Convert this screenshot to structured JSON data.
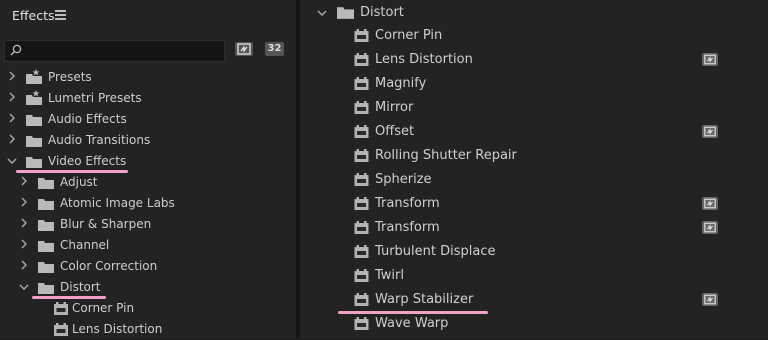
{
  "left_panel": {
    "title": "Effects",
    "search": {
      "value": "",
      "placeholder": ""
    },
    "badge_32": "32",
    "tree": [
      {
        "label": "Presets",
        "level": 0,
        "expanded": false,
        "icon": "preset-folder-icon"
      },
      {
        "label": "Lumetri Presets",
        "level": 0,
        "expanded": false,
        "icon": "preset-folder-icon"
      },
      {
        "label": "Audio Effects",
        "level": 0,
        "expanded": false,
        "icon": "folder-icon"
      },
      {
        "label": "Audio Transitions",
        "level": 0,
        "expanded": false,
        "icon": "folder-icon"
      },
      {
        "label": "Video Effects",
        "level": 0,
        "expanded": true,
        "icon": "folder-icon",
        "highlighted": true
      },
      {
        "label": "Adjust",
        "level": 1,
        "expanded": false,
        "icon": "folder-icon"
      },
      {
        "label": "Atomic Image Labs",
        "level": 1,
        "expanded": false,
        "icon": "folder-icon"
      },
      {
        "label": "Blur & Sharpen",
        "level": 1,
        "expanded": false,
        "icon": "folder-icon"
      },
      {
        "label": "Channel",
        "level": 1,
        "expanded": false,
        "icon": "folder-icon"
      },
      {
        "label": "Color Correction",
        "level": 1,
        "expanded": false,
        "icon": "folder-icon"
      },
      {
        "label": "Distort",
        "level": 1,
        "expanded": true,
        "icon": "folder-icon",
        "highlighted": true
      },
      {
        "label": "Corner Pin",
        "level": 2,
        "icon": "effect-icon"
      },
      {
        "label": "Lens Distortion",
        "level": 2,
        "icon": "effect-icon"
      }
    ]
  },
  "right_panel": {
    "folder": {
      "label": "Distort",
      "expanded": true
    },
    "effects": [
      {
        "label": "Corner Pin",
        "accelerated": false
      },
      {
        "label": "Lens Distortion",
        "accelerated": true
      },
      {
        "label": "Magnify",
        "accelerated": false
      },
      {
        "label": "Mirror",
        "accelerated": false
      },
      {
        "label": "Offset",
        "accelerated": true
      },
      {
        "label": "Rolling Shutter Repair",
        "accelerated": false
      },
      {
        "label": "Spherize",
        "accelerated": false
      },
      {
        "label": "Transform",
        "accelerated": true
      },
      {
        "label": "Transform",
        "accelerated": true
      },
      {
        "label": "Turbulent Displace",
        "accelerated": false
      },
      {
        "label": "Twirl",
        "accelerated": false
      },
      {
        "label": "Warp Stabilizer",
        "accelerated": true,
        "highlighted": true
      },
      {
        "label": "Wave Warp",
        "accelerated": false
      }
    ]
  },
  "colors": {
    "highlight": "#f2a0c4",
    "panel_bg": "#232323",
    "text": "#cdcdcd"
  }
}
